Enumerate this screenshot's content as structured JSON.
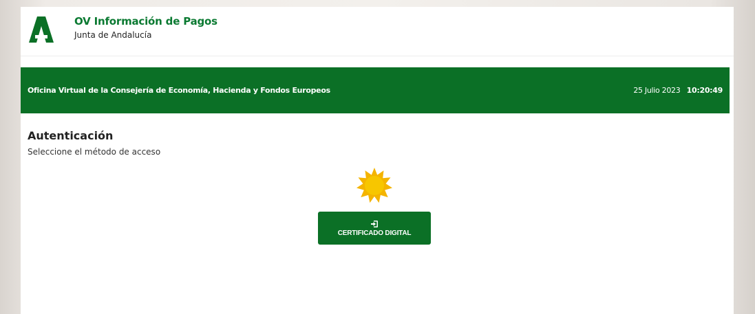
{
  "header": {
    "app_title": "OV Información de Pagos",
    "org_name": "Junta de Andalucía",
    "logo_icon": "junta-andalucia-logo-icon"
  },
  "banner": {
    "title": "Oficina Virtual de la Consejería de Economía, Hacienda y Fondos Europeos",
    "date": "25 Julio 2023",
    "time": "10:20:49"
  },
  "auth": {
    "title": "Autenticación",
    "subtitle": "Seleccione el método de acceso",
    "loading_icon": "sun-icon",
    "cert_button_label": "CERTIFICADO DIGITAL",
    "cert_button_icon": "sign-in-icon"
  },
  "colors": {
    "brand_green": "#0b7026",
    "title_green": "#0b7a32",
    "sun_yellow": "#f7c600",
    "sun_ray": "#f2a900"
  }
}
